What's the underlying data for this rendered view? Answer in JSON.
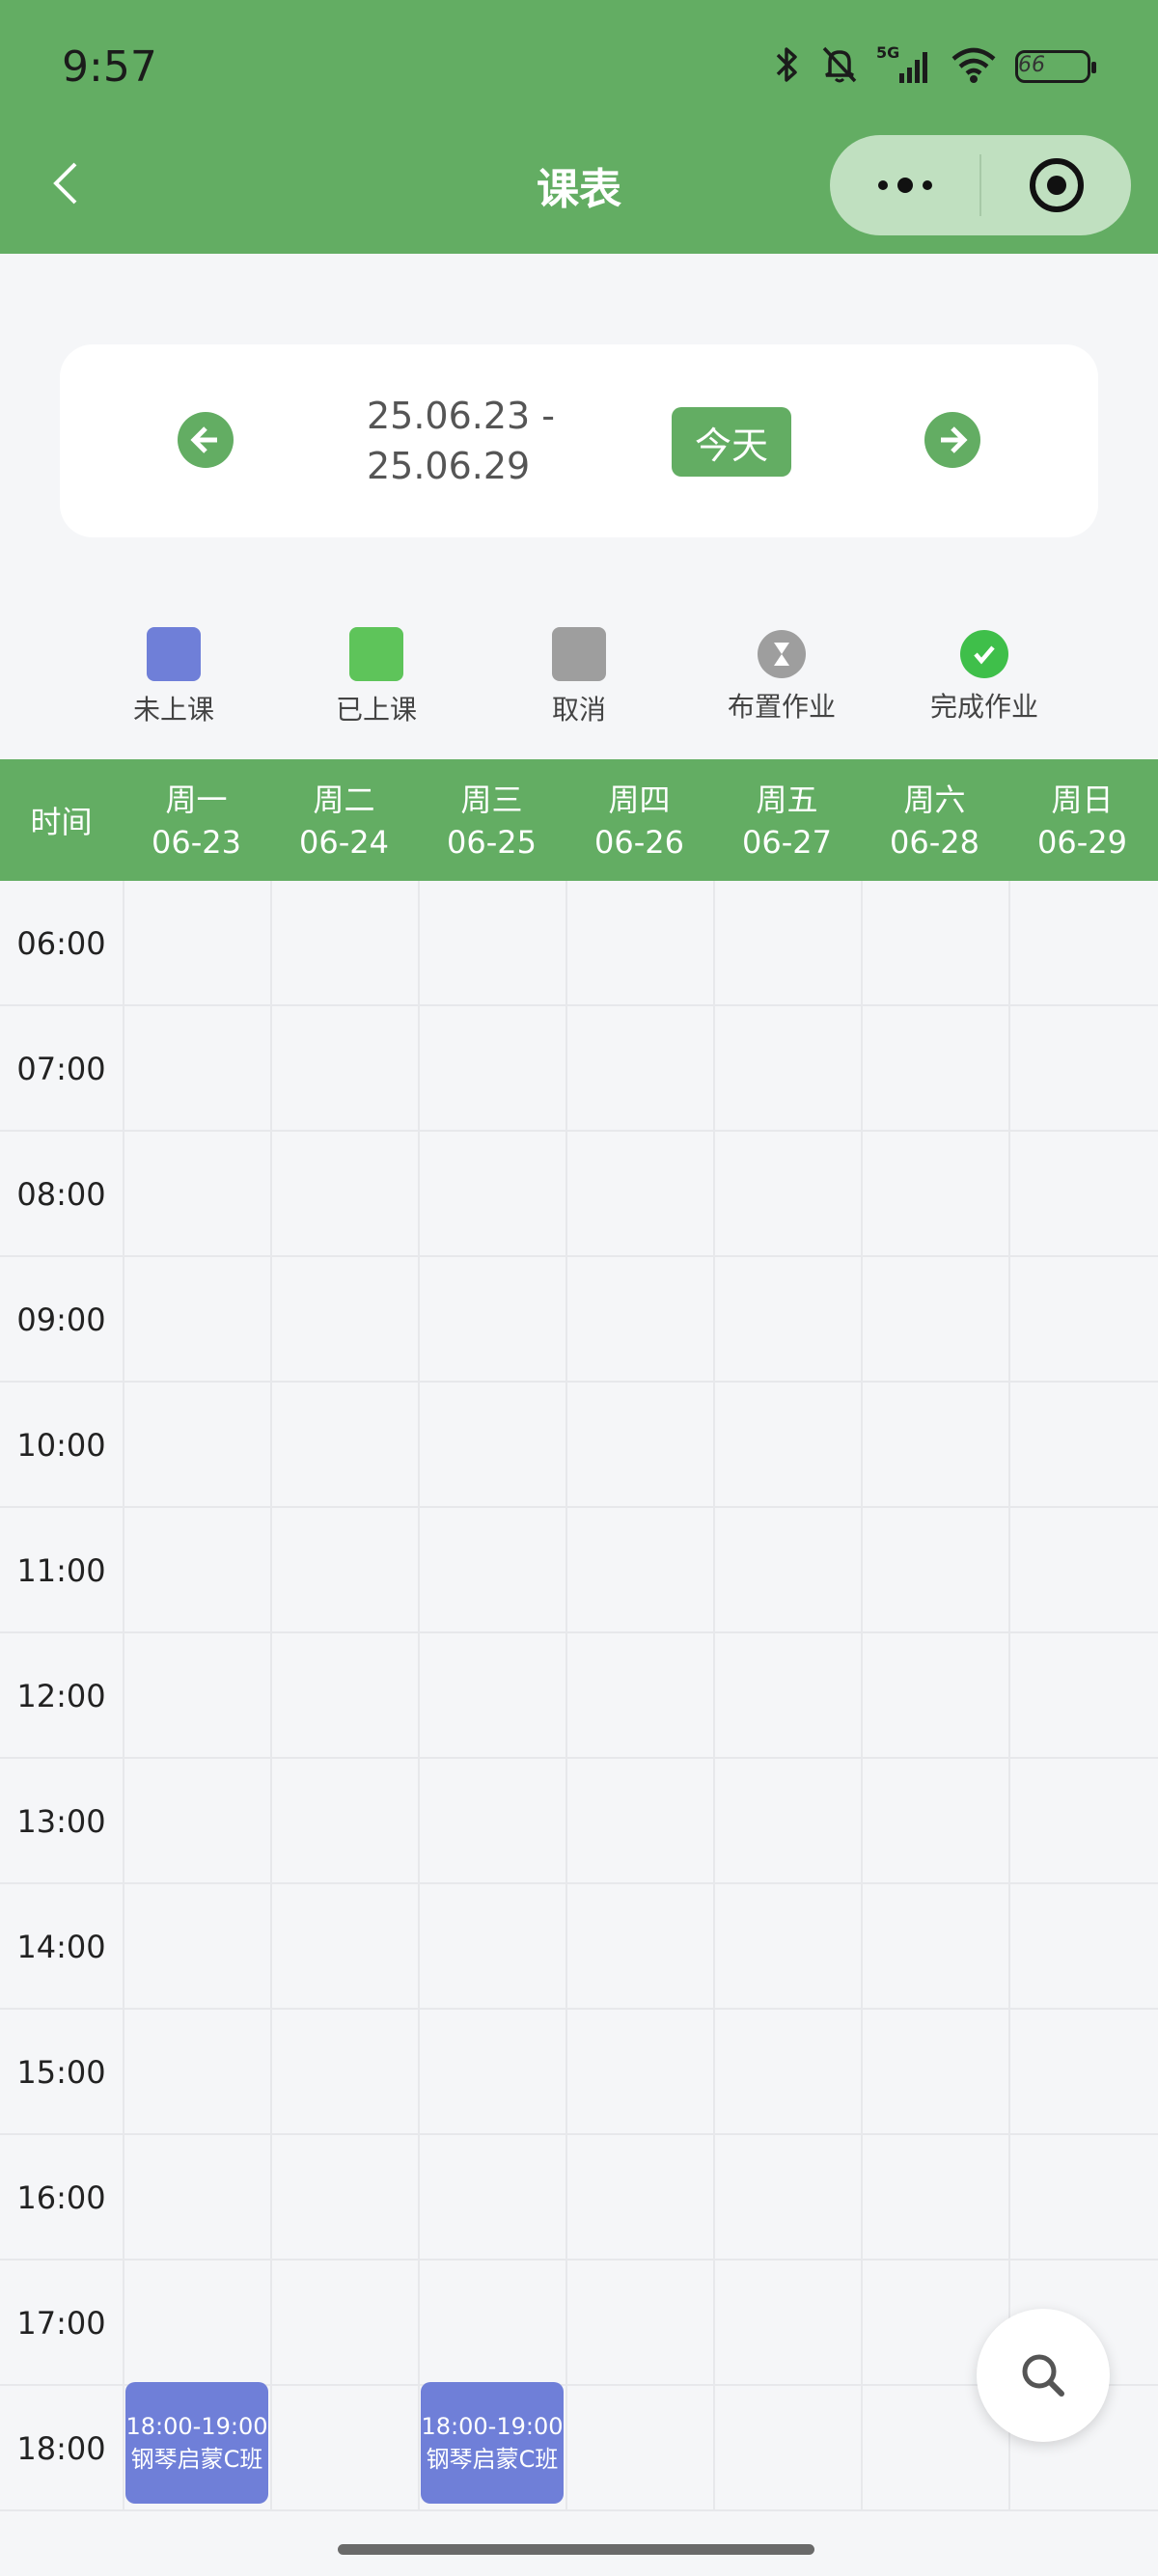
{
  "status_bar": {
    "time": "9:57",
    "battery": "66",
    "network": "5G"
  },
  "header": {
    "title": "课表"
  },
  "week": {
    "range_line1": "25.06.23 -",
    "range_line2": "25.06.29",
    "today_label": "今天"
  },
  "legend": [
    {
      "label": "未上课",
      "color": "#6f7fd8",
      "kind": "swatch"
    },
    {
      "label": "已上课",
      "color": "#5ec45a",
      "kind": "swatch"
    },
    {
      "label": "取消",
      "color": "#9e9e9e",
      "kind": "swatch"
    },
    {
      "label": "布置作业",
      "color": "#9e9e9e",
      "kind": "hourglass-icon"
    },
    {
      "label": "完成作业",
      "color": "#3fbf4a",
      "kind": "check-icon"
    }
  ],
  "schedule": {
    "time_header": "时间",
    "days": [
      {
        "weekday": "周一",
        "date": "06-23"
      },
      {
        "weekday": "周二",
        "date": "06-24"
      },
      {
        "weekday": "周三",
        "date": "06-25"
      },
      {
        "weekday": "周四",
        "date": "06-26"
      },
      {
        "weekday": "周五",
        "date": "06-27"
      },
      {
        "weekday": "周六",
        "date": "06-28"
      },
      {
        "weekday": "周日",
        "date": "06-29"
      }
    ],
    "times": [
      "06:00",
      "07:00",
      "08:00",
      "09:00",
      "10:00",
      "11:00",
      "12:00",
      "13:00",
      "14:00",
      "15:00",
      "16:00",
      "17:00",
      "18:00"
    ],
    "courses": [
      {
        "day": 0,
        "slot": 12,
        "time": "18:00-19:00",
        "name": "钢琴启蒙C班"
      },
      {
        "day": 2,
        "slot": 12,
        "time": "18:00-19:00",
        "name": "钢琴启蒙C班"
      }
    ]
  }
}
